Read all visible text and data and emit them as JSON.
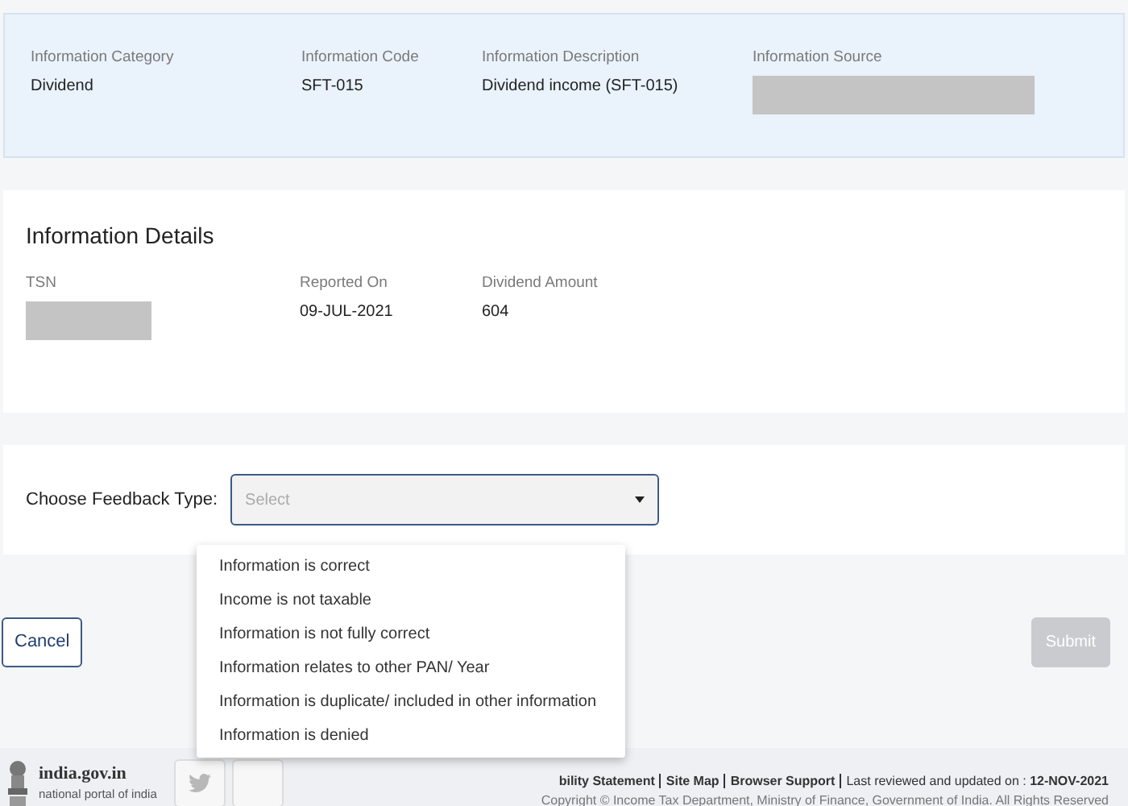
{
  "summary": {
    "fields": [
      {
        "label": "Information Category",
        "kind": "text",
        "value": "Dividend"
      },
      {
        "label": "Information Code",
        "kind": "text",
        "value": "SFT-015"
      },
      {
        "label": "Information Description",
        "kind": "text",
        "value": "Dividend income (SFT-015)"
      },
      {
        "label": "Information Source",
        "kind": "redacted"
      }
    ]
  },
  "details": {
    "title": "Information Details",
    "fields": [
      {
        "label": "TSN",
        "kind": "redacted"
      },
      {
        "label": "Reported On",
        "kind": "text",
        "value": "09-JUL-2021"
      },
      {
        "label": "Dividend Amount",
        "kind": "text",
        "value": "604"
      }
    ]
  },
  "feedback": {
    "label": "Choose Feedback Type:",
    "placeholder": "Select",
    "expanded": true,
    "options": [
      "Information is correct",
      "Income is not taxable",
      "Information is not fully correct",
      "Information relates to other PAN/ Year",
      "Information is duplicate/ included in other information",
      "Information is denied"
    ]
  },
  "buttons": [
    {
      "label": "Cancel",
      "kind": "secondary",
      "disabled": false
    },
    {
      "label": "Submit",
      "kind": "primary",
      "disabled": true
    }
  ],
  "footer": {
    "site": "india.gov.in",
    "tagline": "national portal of india",
    "links": [
      "bility Statement",
      "Site Map",
      "Browser Support"
    ],
    "updated": "Last reviewed and updated on : **12-NOV-2021**",
    "copyright": "Copyright © Income Tax Department, Ministry of Finance, Government of India. All Rights Reserved"
  }
}
